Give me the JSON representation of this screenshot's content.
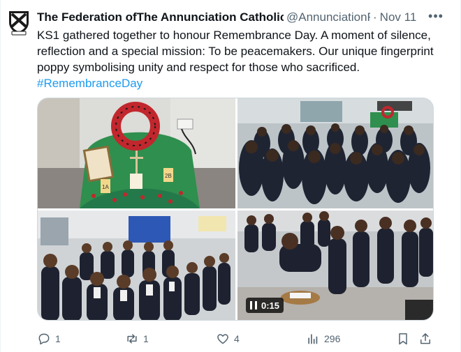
{
  "tweet": {
    "author_name": "The Federation ofThe Annunciation Catholic School",
    "handle": "@AnnunciationFed",
    "separator": "·",
    "date": "Nov 11",
    "more_label": "•••",
    "text_main": "KS1 gathered together to honour Remembrance Day. A moment of silence, reflection and a special mission: To be peacemakers. Our unique fingerprint poppy symbolising unity and respect for those who sacrificed.",
    "hashtag": "#RemembranceDay",
    "media": {
      "video_duration": "0:15",
      "pause_icon": "pause-icon",
      "wreath_labels": [
        "1A",
        "2B"
      ]
    },
    "actions": {
      "replies": "1",
      "reposts": "1",
      "likes": "4",
      "views": "296"
    }
  },
  "colors": {
    "text": "#0f1419",
    "secondary": "#536471",
    "link": "#1d9bf0",
    "border": "#cfd9de"
  }
}
